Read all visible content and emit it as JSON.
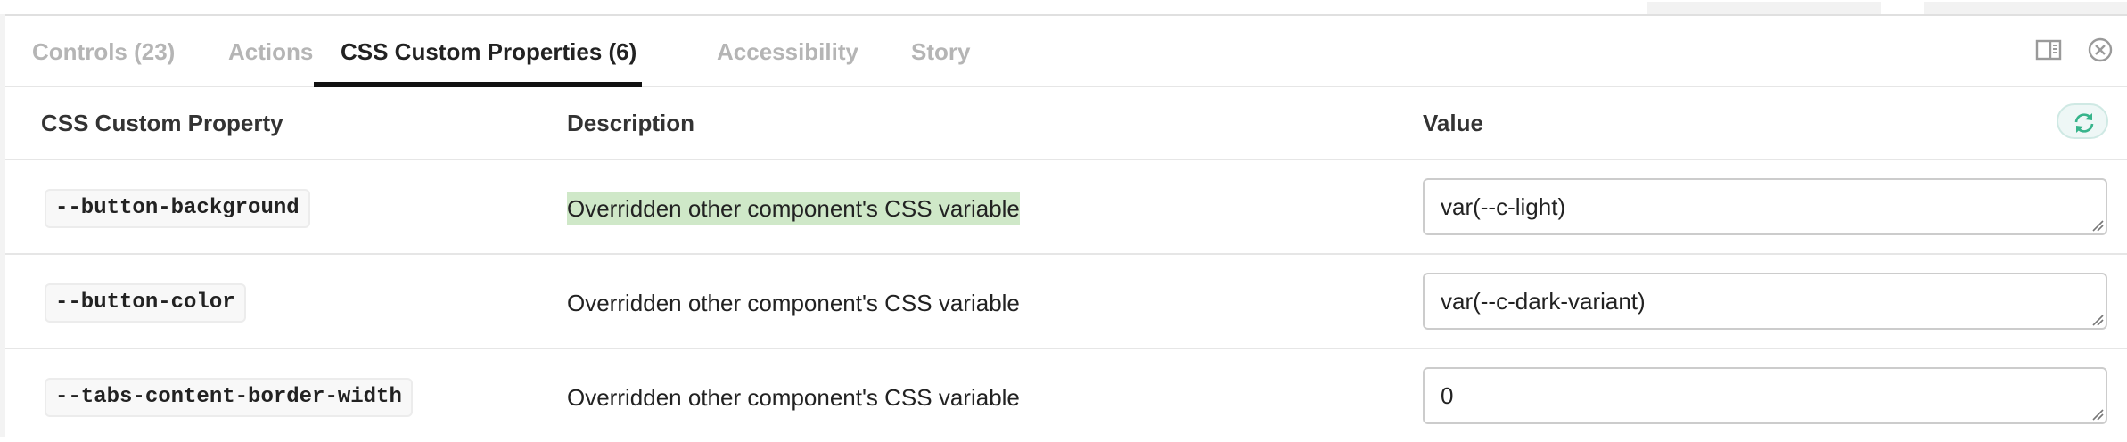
{
  "tabs": [
    {
      "label": "Controls (23)",
      "active": false
    },
    {
      "label": "Actions",
      "active": false
    },
    {
      "label": "CSS Custom Properties (6)",
      "active": true
    },
    {
      "label": "Accessibility",
      "active": false
    },
    {
      "label": "Story",
      "active": false
    }
  ],
  "tab_controls": {
    "panel_icon": "panel-orientation-icon",
    "close_icon": "close-icon"
  },
  "table": {
    "headers": {
      "property": "CSS Custom Property",
      "description": "Description",
      "value": "Value"
    },
    "reset_icon": "reset-sync-icon",
    "accent": "#37b48b",
    "rows": [
      {
        "property": "--button-background",
        "description": "Overridden other component's CSS variable",
        "value": "var(--c-light)",
        "highlighted": true
      },
      {
        "property": "--button-color",
        "description": "Overridden other component's CSS variable",
        "value": "var(--c-dark-variant)",
        "highlighted": false
      },
      {
        "property": "--tabs-content-border-width",
        "description": "Overridden other component's CSS variable",
        "value": "0",
        "highlighted": false
      }
    ]
  },
  "colors": {
    "highlight": "#cfe8c8",
    "active_tab_underline": "#111111",
    "inactive_tab": "#b5b5b5"
  }
}
